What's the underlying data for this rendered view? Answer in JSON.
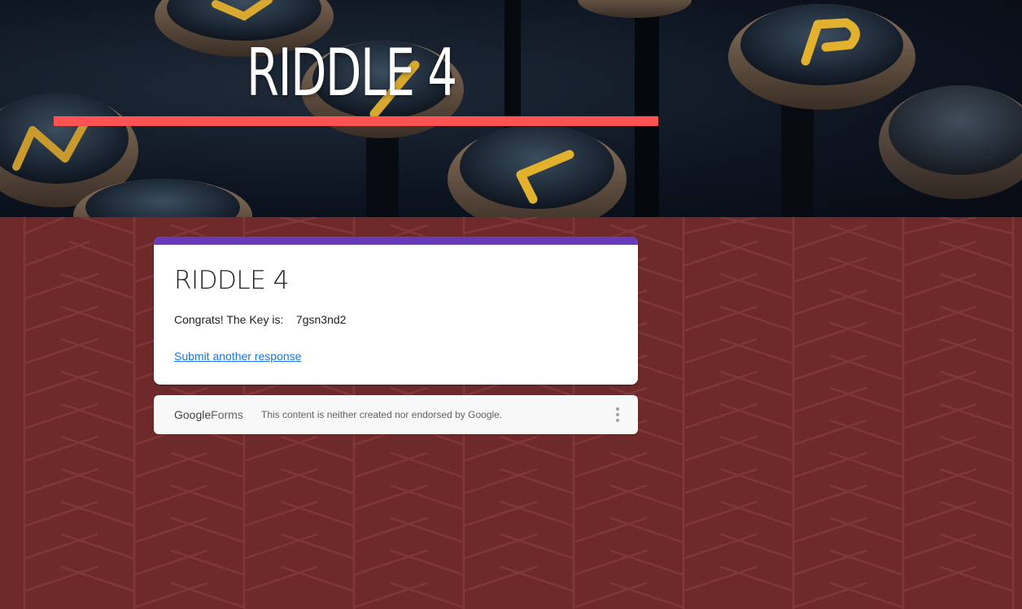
{
  "banner": {
    "title": "RIDDLE 4",
    "accent_color": "#ff5252"
  },
  "form": {
    "title": "RIDDLE 4",
    "confirmation": "Congrats! The Key is:    7gsn3nd2",
    "submit_another_label": "Submit another response",
    "theme_color": "#673ab7",
    "background_color": "#6e2a2a"
  },
  "footer": {
    "logo_google": "Google",
    "logo_forms": "Forms",
    "disclaimer": "This content is neither created nor endorsed by Google.",
    "menu_icon": "more-vert-icon"
  }
}
